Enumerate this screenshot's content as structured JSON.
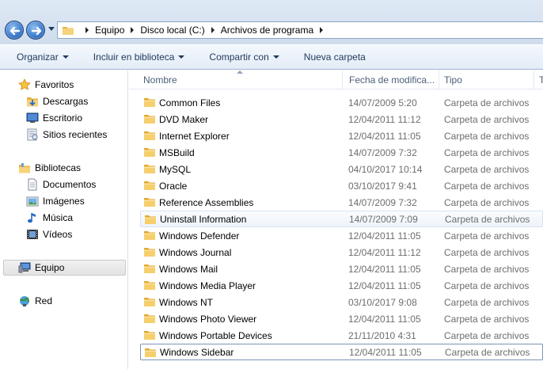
{
  "address": {
    "breadcrumbs": [
      "Equipo",
      "Disco local (C:)",
      "Archivos de programa"
    ]
  },
  "toolbar": {
    "organize": "Organizar",
    "include_library": "Incluir en biblioteca",
    "share_with": "Compartir con",
    "new_folder": "Nueva carpeta"
  },
  "nav": {
    "favorites": "Favoritos",
    "downloads": "Descargas",
    "desktop": "Escritorio",
    "recent": "Sitios recientes",
    "libraries": "Bibliotecas",
    "documents": "Documentos",
    "images": "Imágenes",
    "music": "Música",
    "videos": "Vídeos",
    "computer": "Equipo",
    "network": "Red"
  },
  "columns": {
    "name": "Nombre",
    "date": "Fecha de modifica...",
    "type": "Tipo",
    "size": "T"
  },
  "files": [
    {
      "name": "Common Files",
      "date": "14/07/2009 5:20",
      "type": "Carpeta de archivos"
    },
    {
      "name": "DVD Maker",
      "date": "12/04/2011 11:12",
      "type": "Carpeta de archivos"
    },
    {
      "name": "Internet Explorer",
      "date": "12/04/2011 11:05",
      "type": "Carpeta de archivos"
    },
    {
      "name": "MSBuild",
      "date": "14/07/2009 7:32",
      "type": "Carpeta de archivos"
    },
    {
      "name": "MySQL",
      "date": "04/10/2017 10:14",
      "type": "Carpeta de archivos"
    },
    {
      "name": "Oracle",
      "date": "03/10/2017 9:41",
      "type": "Carpeta de archivos"
    },
    {
      "name": "Reference Assemblies",
      "date": "14/07/2009 7:32",
      "type": "Carpeta de archivos"
    },
    {
      "name": "Uninstall Information",
      "date": "14/07/2009 7:09",
      "type": "Carpeta de archivos"
    },
    {
      "name": "Windows Defender",
      "date": "12/04/2011 11:05",
      "type": "Carpeta de archivos"
    },
    {
      "name": "Windows Journal",
      "date": "12/04/2011 11:12",
      "type": "Carpeta de archivos"
    },
    {
      "name": "Windows Mail",
      "date": "12/04/2011 11:05",
      "type": "Carpeta de archivos"
    },
    {
      "name": "Windows Media Player",
      "date": "12/04/2011 11:05",
      "type": "Carpeta de archivos"
    },
    {
      "name": "Windows NT",
      "date": "03/10/2017 9:08",
      "type": "Carpeta de archivos"
    },
    {
      "name": "Windows Photo Viewer",
      "date": "12/04/2011 11:05",
      "type": "Carpeta de archivos"
    },
    {
      "name": "Windows Portable Devices",
      "date": "21/11/2010 4:31",
      "type": "Carpeta de archivos"
    },
    {
      "name": "Windows Sidebar",
      "date": "12/04/2011 11:05",
      "type": "Carpeta de archivos"
    }
  ],
  "colors": {
    "folder": "#f2c55c",
    "accent": "#2b6cc4"
  }
}
